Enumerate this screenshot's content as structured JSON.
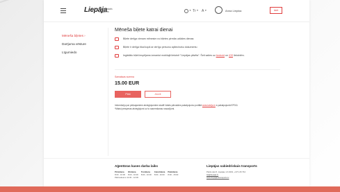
{
  "header": {
    "logo": "Liepāja",
    "logo_sub": "Sabiedriskais transports",
    "lang_label": "LV",
    "font_label": "Tr",
    "contrast_label": "A",
    "user_name": "Anna Liepiņa",
    "exit_label": "Iziet"
  },
  "sidebar": {
    "items": [
      {
        "label": "Mēneša biļetes ›"
      },
      {
        "label": "Darījuma vēsture"
      },
      {
        "label": "Līgumiedo"
      }
    ]
  },
  "main": {
    "title": "Mēneša biļete katrai dienai",
    "info": [
      {
        "icon": "calendar-icon",
        "text": "Biļete derīga vienam mēnesim no biļetes pirmās uzlādes dienas"
      },
      {
        "icon": "card-icon",
        "text": "Biļete ir derīga tikai kopā ar derīgu personu apliecinošu dokumentu"
      },
      {
        "icon": "phone-icon",
        "text_before": "Iegādāto biļeti iespējams izmantot mobilajā lietotnē \"Liepājas pilsēta\". Šeit saites uz",
        "link1": "Android",
        "text_mid": "un",
        "link2": "iOS",
        "text_after": "lietotnēm."
      }
    ],
    "price_label": "Samaksas summa",
    "price": "15.00 EUR",
    "pay_button": "Pirkt",
    "cancel_button": "Atcelt",
    "note_before": "Informāciju par pieļaujamiem atvieglojumiem skatīt Valsts pārvaldes pakalpojumu portālā",
    "note_link": "www.latvija.lv",
    "note_after": "e-pakalpojumā EP011",
    "note_line2": "*Maksi presperas atvieglojumi uz to saņemšanas nosacījumi."
  },
  "footer": {
    "hours_title": "Aģentūras kases darba laiks",
    "days": [
      "Pirmdiena",
      "Otrdiena",
      "Trešdiena",
      "Ceturtdiena",
      "Piektdiena"
    ],
    "times": [
      "8:00 - 16:00",
      "8:00 - 16:00",
      "8:00 - 16:00",
      "8:00 - 16:00",
      "8:00 - 15:00"
    ],
    "lunch": "Pārtraukums 11:30 - 12:00",
    "contact_title": "Liepājas sabiedriskais transports",
    "address": "Peldu iela 5, Liepāja, LV-3401, +371 29 744",
    "email": "lst@liepaja.lv",
    "site": "www.liepajastransports.lv"
  }
}
